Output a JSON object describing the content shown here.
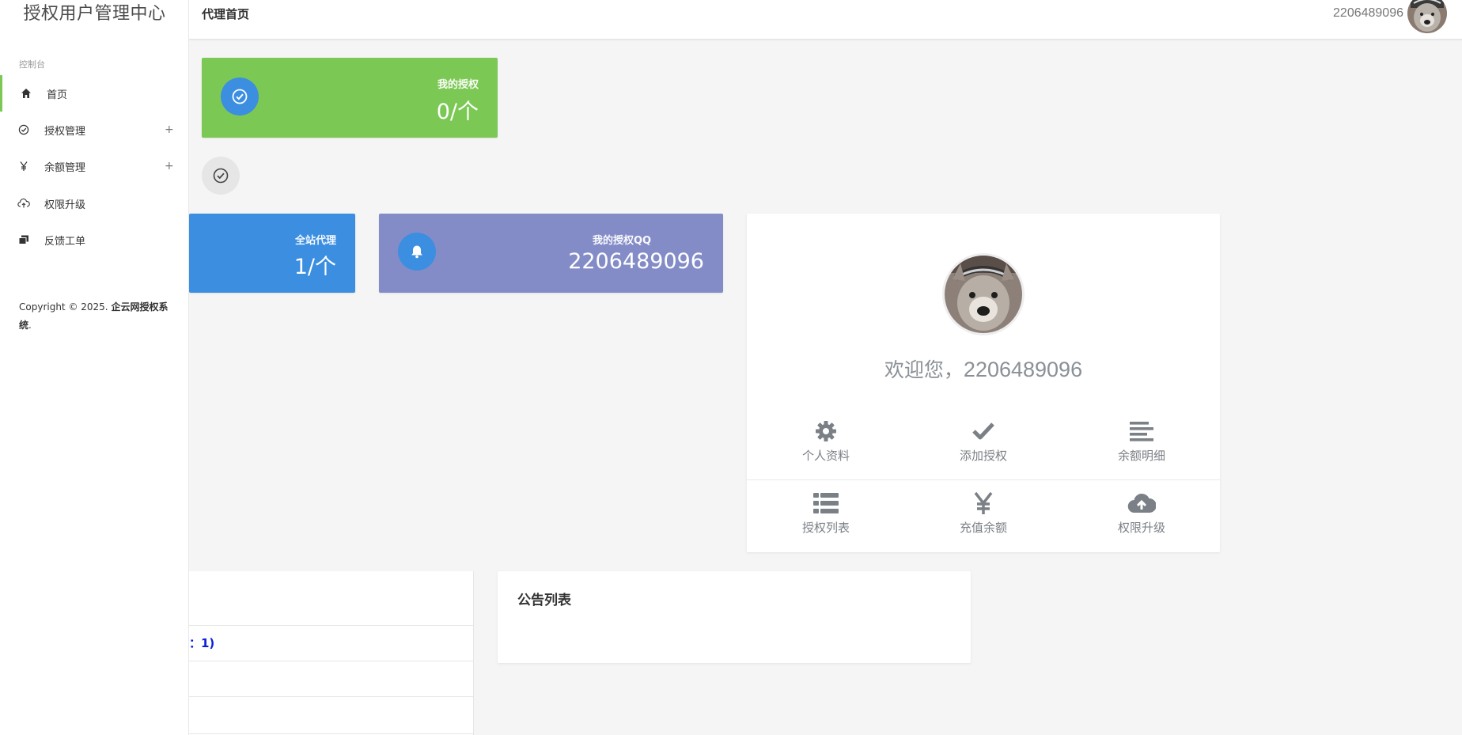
{
  "sidebar": {
    "brand": "授权用户管理中心",
    "section_label": "控制台",
    "items": [
      {
        "label": "首页",
        "icon": "home-icon",
        "active": true
      },
      {
        "label": "授权管理",
        "icon": "check-circle-icon",
        "expand": "+"
      },
      {
        "label": "余额管理",
        "icon": "yen-icon",
        "expand": "+"
      },
      {
        "label": "权限升级",
        "icon": "cloud-upload-icon"
      },
      {
        "label": "反馈工单",
        "icon": "tickets-icon"
      }
    ],
    "copyright_prefix": "Copyright © 2025. ",
    "copyright_name": "企云网授权系统",
    "copyright_suffix": "."
  },
  "header": {
    "page_title": "代理首页",
    "username": "2206489096"
  },
  "cards": {
    "my_auth": {
      "label": "我的授权",
      "value": "0/个",
      "color": "#7cc855"
    },
    "site_agents": {
      "label": "全站代理",
      "value": "1/个",
      "color": "#3b8ee0"
    },
    "my_qq": {
      "label": "我的授权QQ",
      "value": "2206489096",
      "color": "#848cc8"
    }
  },
  "profile": {
    "welcome_prefix": "欢迎您，",
    "welcome_name": "2206489096",
    "shortcuts": [
      {
        "label": "个人资料",
        "icon": "gear-icon"
      },
      {
        "label": "添加授权",
        "icon": "check-icon"
      },
      {
        "label": "余额明细",
        "icon": "align-left-icon"
      },
      {
        "label": "授权列表",
        "icon": "list-icon"
      },
      {
        "label": "充值余额",
        "icon": "yen-icon"
      },
      {
        "label": "权限升级",
        "icon": "cloud-upload-icon"
      }
    ]
  },
  "panels": {
    "left_row_text": "：1)",
    "announcements_title": "公告列表"
  },
  "colors": {
    "accent_green": "#7cc855",
    "accent_blue": "#3b8ee0",
    "accent_purple": "#848cc8",
    "link_blue": "#0b1ed6"
  }
}
